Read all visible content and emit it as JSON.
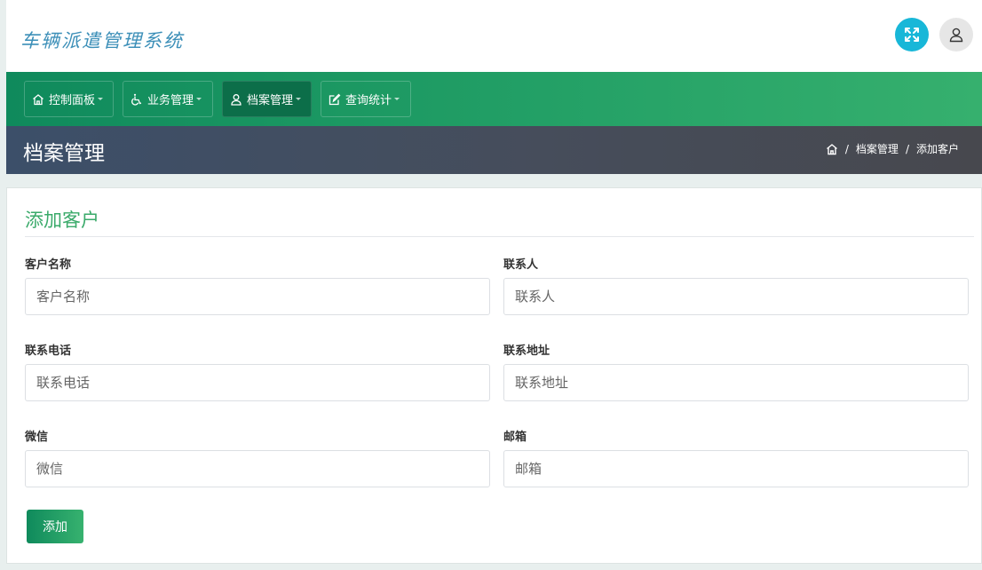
{
  "app": {
    "title": "车辆派遣管理系统"
  },
  "header": {
    "fullscreen_icon": "expand-arrows-icon",
    "user_icon": "user-icon"
  },
  "nav": {
    "items": [
      {
        "label": "控制面板",
        "icon": "home-icon"
      },
      {
        "label": "业务管理",
        "icon": "wheelchair-icon"
      },
      {
        "label": "档案管理",
        "icon": "user-icon",
        "active": true
      },
      {
        "label": "查询统计",
        "icon": "edit-icon"
      }
    ]
  },
  "page": {
    "title": "档案管理",
    "breadcrumb": [
      "档案管理",
      "添加客户"
    ]
  },
  "form": {
    "title": "添加客户",
    "fields": [
      {
        "label": "客户名称",
        "placeholder": "客户名称"
      },
      {
        "label": "联系人",
        "placeholder": "联系人"
      },
      {
        "label": "联系电话",
        "placeholder": "联系电话"
      },
      {
        "label": "联系地址",
        "placeholder": "联系地址"
      },
      {
        "label": "微信",
        "placeholder": "微信"
      },
      {
        "label": "邮箱",
        "placeholder": "邮箱"
      }
    ],
    "submit_label": "添加"
  },
  "colors": {
    "brand_green": "#23a066",
    "title_green": "#3aaa6a",
    "accent_cyan": "#18b7d8",
    "titlebar_dark": "#464d5b"
  }
}
